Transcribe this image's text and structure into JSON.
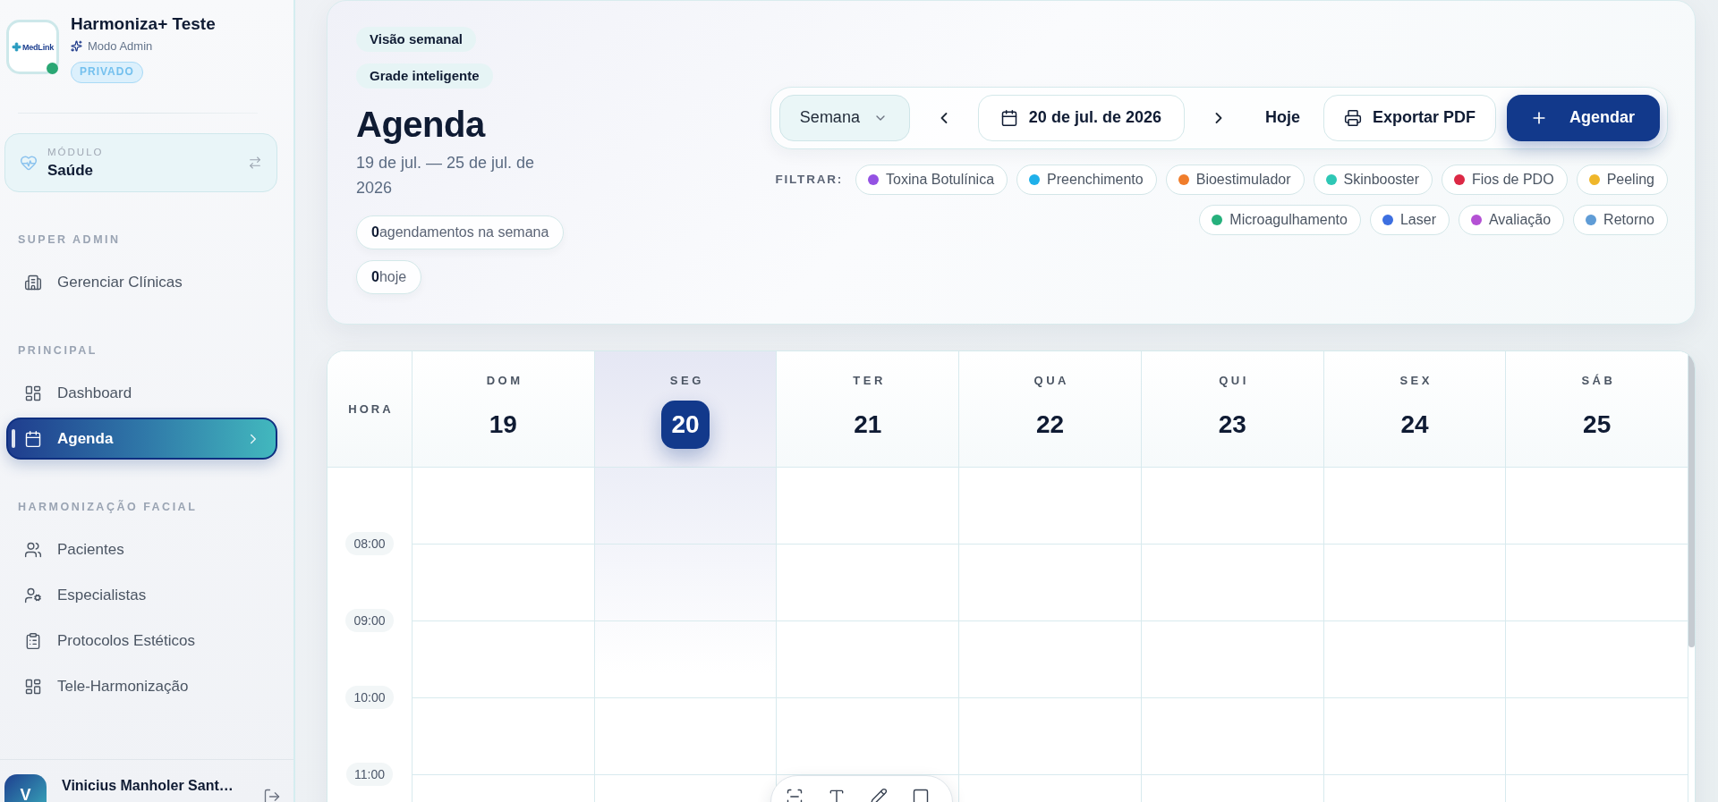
{
  "sidebar": {
    "brand": {
      "logo_text": "MedLink",
      "name": "Harmoniza+ Teste",
      "role": "Modo Admin",
      "badge": "PRIVADO",
      "online": true
    },
    "module": {
      "label": "MÓDULO",
      "value": "Saúde"
    },
    "sections": [
      {
        "title": "SUPER ADMIN",
        "items": [
          {
            "label": "Gerenciar Clínicas",
            "selected": false
          }
        ]
      },
      {
        "title": "PRINCIPAL",
        "items": [
          {
            "label": "Dashboard",
            "selected": false
          },
          {
            "label": "Agenda",
            "selected": true
          }
        ]
      },
      {
        "title": "HARMONIZAÇÃO FACIAL",
        "items": [
          {
            "label": "Pacientes",
            "selected": false
          },
          {
            "label": "Especialistas",
            "selected": false
          },
          {
            "label": "Protocolos Estéticos",
            "selected": false
          },
          {
            "label": "Tele-Harmonização",
            "selected": false
          }
        ]
      }
    ],
    "user": {
      "initial": "V",
      "name": "Vinicius Manholer Sant…"
    }
  },
  "header": {
    "tags": [
      "Visão semanal",
      "Grade inteligente"
    ],
    "title": "Agenda",
    "range": "19 de jul. — 25 de jul. de 2026",
    "stats": [
      "**0**agendamentos na semana",
      "**0**hoje"
    ],
    "toolbar": {
      "view": "Semana",
      "date": "20 de jul. de 2026",
      "today": "Hoje",
      "export": "Exportar PDF",
      "create": "Agendar"
    },
    "filter_label": "FILTRAR:",
    "filters": [
      {
        "label": "Toxina Botulínica",
        "color": "#9452e3"
      },
      {
        "label": "Preenchimento",
        "color": "#1fb0ea"
      },
      {
        "label": "Bioestimulador",
        "color": "#f07d2b"
      },
      {
        "label": "Skinbooster",
        "color": "#2ec7b5"
      },
      {
        "label": "Fios de PDO",
        "color": "#dc2845"
      },
      {
        "label": "Peeling",
        "color": "#efb62a"
      },
      {
        "label": "Microagulhamento",
        "color": "#26b07c"
      },
      {
        "label": "Laser",
        "color": "#3d6fe0"
      },
      {
        "label": "Avaliação",
        "color": "#b451d4"
      },
      {
        "label": "Retorno",
        "color": "#5f9cd6"
      }
    ]
  },
  "calendar": {
    "hour_label": "HORA",
    "days": [
      {
        "name": "DOM",
        "number": "19",
        "today": false
      },
      {
        "name": "SEG",
        "number": "20",
        "today": true
      },
      {
        "name": "TER",
        "number": "21",
        "today": false
      },
      {
        "name": "QUA",
        "number": "22",
        "today": false
      },
      {
        "name": "QUI",
        "number": "23",
        "today": false
      },
      {
        "name": "SEX",
        "number": "24",
        "today": false
      },
      {
        "name": "SÁB",
        "number": "25",
        "today": false
      }
    ],
    "hours": [
      "08:00",
      "09:00",
      "10:00",
      "11:00"
    ]
  }
}
